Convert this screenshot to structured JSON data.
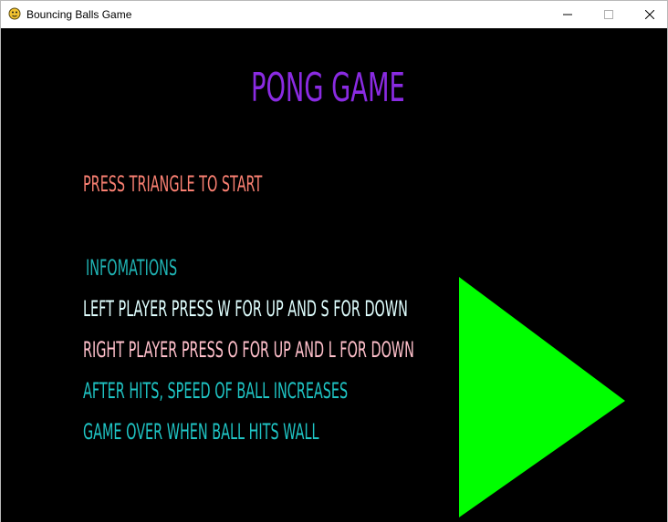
{
  "window": {
    "title": "Bouncing Balls Game",
    "icon": "pygame-snake-icon",
    "controls": {
      "minimize_glyph": "—",
      "maximize_glyph": "☐",
      "close_glyph": "✕"
    }
  },
  "game": {
    "title": "PONG GAME",
    "start_prompt": "PRESS TRIANGLE TO START",
    "info_heading": "INFOMATIONS",
    "info_lines": [
      "LEFT PLAYER PRESS W FOR UP AND S FOR DOWN",
      "RIGHT PLAYER PRESS O FOR UP AND L FOR DOWN",
      "AFTER HITS, SPEED OF BALL INCREASES",
      "GAME OVER WHEN BALL HITS WALL"
    ],
    "start_button": {
      "shape": "triangle",
      "icon": "play-triangle-icon"
    }
  },
  "colors": {
    "background": "#000000",
    "title": "#8a2be2",
    "start_prompt": "#fa8072",
    "info_heading": "#1fb3b3",
    "info_line_1": "#e0ffff",
    "info_line_2": "#ffc0cb",
    "info_line_3": "#1fc4c4",
    "info_line_4": "#1fc4c4",
    "triangle": "#00ff00"
  }
}
